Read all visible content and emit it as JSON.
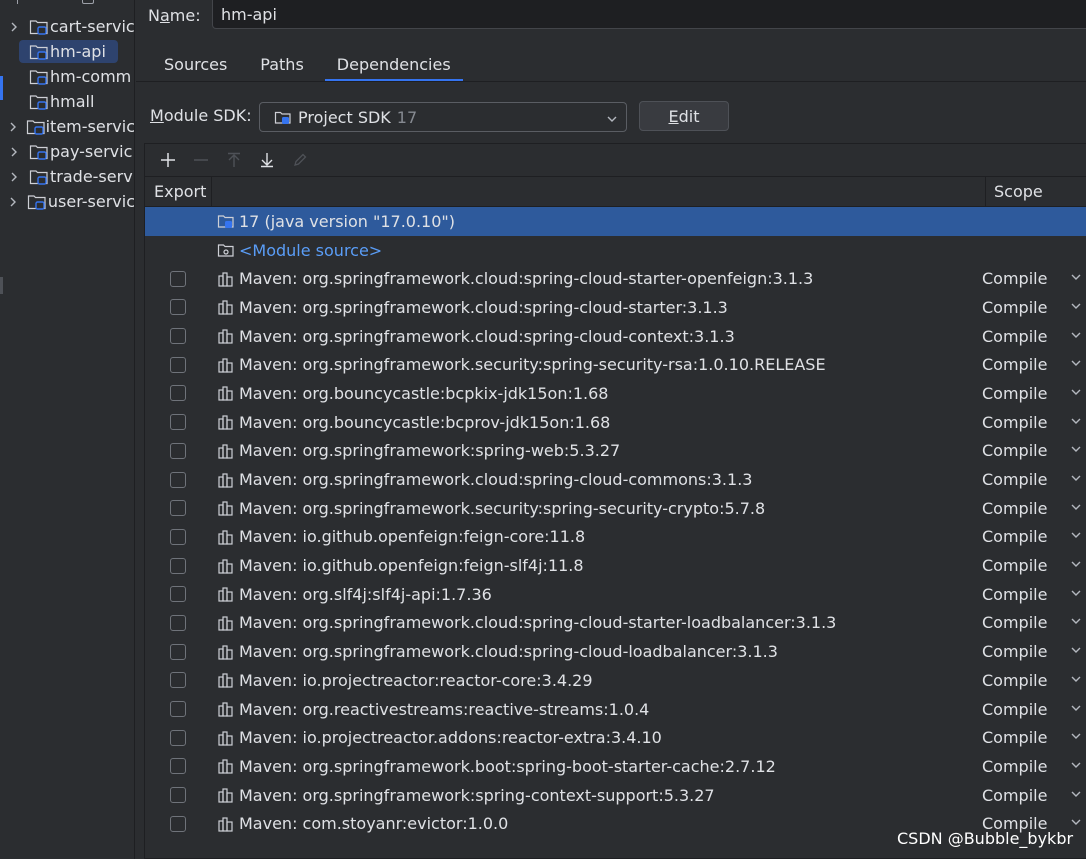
{
  "tree": {
    "items": [
      {
        "label": "cart-servic",
        "expandable": true,
        "selected": false
      },
      {
        "label": "hm-api",
        "expandable": false,
        "selected": true
      },
      {
        "label": "hm-comm",
        "expandable": false,
        "selected": false
      },
      {
        "label": "hmall",
        "expandable": false,
        "selected": false
      },
      {
        "label": "item-servic",
        "expandable": true,
        "selected": false
      },
      {
        "label": "pay-servic",
        "expandable": true,
        "selected": false
      },
      {
        "label": "trade-serv",
        "expandable": true,
        "selected": false
      },
      {
        "label": "user-servic",
        "expandable": true,
        "selected": false
      }
    ]
  },
  "name_field": {
    "label_prefix": "N",
    "label_mnemonic": "a",
    "label_suffix": "me:",
    "value": "hm-api"
  },
  "tabs": [
    {
      "label": "Sources",
      "active": false
    },
    {
      "label": "Paths",
      "active": false
    },
    {
      "label": "Dependencies",
      "active": true
    }
  ],
  "sdk": {
    "label_mnemonic": "M",
    "label_rest": "odule SDK:",
    "selected": "Project SDK",
    "version": "17",
    "edit_mnemonic": "E",
    "edit_rest": "dit"
  },
  "table": {
    "col_export": "Export",
    "col_scope": "Scope",
    "rows": [
      {
        "text": "17 (java version \"17.0.10\")",
        "kind": "sdk",
        "checkbox": false,
        "scope": "",
        "selected": true
      },
      {
        "text": "<Module source>",
        "kind": "source",
        "checkbox": false,
        "scope": "",
        "selected": false
      },
      {
        "text": "Maven: org.springframework.cloud:spring-cloud-starter-openfeign:3.1.3",
        "kind": "lib",
        "checkbox": true,
        "scope": "Compile"
      },
      {
        "text": "Maven: org.springframework.cloud:spring-cloud-starter:3.1.3",
        "kind": "lib",
        "checkbox": true,
        "scope": "Compile"
      },
      {
        "text": "Maven: org.springframework.cloud:spring-cloud-context:3.1.3",
        "kind": "lib",
        "checkbox": true,
        "scope": "Compile"
      },
      {
        "text": "Maven: org.springframework.security:spring-security-rsa:1.0.10.RELEASE",
        "kind": "lib",
        "checkbox": true,
        "scope": "Compile"
      },
      {
        "text": "Maven: org.bouncycastle:bcpkix-jdk15on:1.68",
        "kind": "lib",
        "checkbox": true,
        "scope": "Compile"
      },
      {
        "text": "Maven: org.bouncycastle:bcprov-jdk15on:1.68",
        "kind": "lib",
        "checkbox": true,
        "scope": "Compile"
      },
      {
        "text": "Maven: org.springframework:spring-web:5.3.27",
        "kind": "lib",
        "checkbox": true,
        "scope": "Compile"
      },
      {
        "text": "Maven: org.springframework.cloud:spring-cloud-commons:3.1.3",
        "kind": "lib",
        "checkbox": true,
        "scope": "Compile"
      },
      {
        "text": "Maven: org.springframework.security:spring-security-crypto:5.7.8",
        "kind": "lib",
        "checkbox": true,
        "scope": "Compile"
      },
      {
        "text": "Maven: io.github.openfeign:feign-core:11.8",
        "kind": "lib",
        "checkbox": true,
        "scope": "Compile"
      },
      {
        "text": "Maven: io.github.openfeign:feign-slf4j:11.8",
        "kind": "lib",
        "checkbox": true,
        "scope": "Compile"
      },
      {
        "text": "Maven: org.slf4j:slf4j-api:1.7.36",
        "kind": "lib",
        "checkbox": true,
        "scope": "Compile"
      },
      {
        "text": "Maven: org.springframework.cloud:spring-cloud-starter-loadbalancer:3.1.3",
        "kind": "lib",
        "checkbox": true,
        "scope": "Compile"
      },
      {
        "text": "Maven: org.springframework.cloud:spring-cloud-loadbalancer:3.1.3",
        "kind": "lib",
        "checkbox": true,
        "scope": "Compile"
      },
      {
        "text": "Maven: io.projectreactor:reactor-core:3.4.29",
        "kind": "lib",
        "checkbox": true,
        "scope": "Compile"
      },
      {
        "text": "Maven: org.reactivestreams:reactive-streams:1.0.4",
        "kind": "lib",
        "checkbox": true,
        "scope": "Compile"
      },
      {
        "text": "Maven: io.projectreactor.addons:reactor-extra:3.4.10",
        "kind": "lib",
        "checkbox": true,
        "scope": "Compile"
      },
      {
        "text": "Maven: org.springframework.boot:spring-boot-starter-cache:2.7.12",
        "kind": "lib",
        "checkbox": true,
        "scope": "Compile"
      },
      {
        "text": "Maven: org.springframework:spring-context-support:5.3.27",
        "kind": "lib",
        "checkbox": true,
        "scope": "Compile"
      },
      {
        "text": "Maven: com.stoyanr:evictor:1.0.0",
        "kind": "lib",
        "checkbox": true,
        "scope": "Compile"
      }
    ]
  },
  "watermark": "CSDN @Bubble_bykbr",
  "colors": {
    "background": "#2b2d30",
    "accent": "#3574f0",
    "selection_row": "#2e5a9c",
    "link": "#5a9df7"
  }
}
